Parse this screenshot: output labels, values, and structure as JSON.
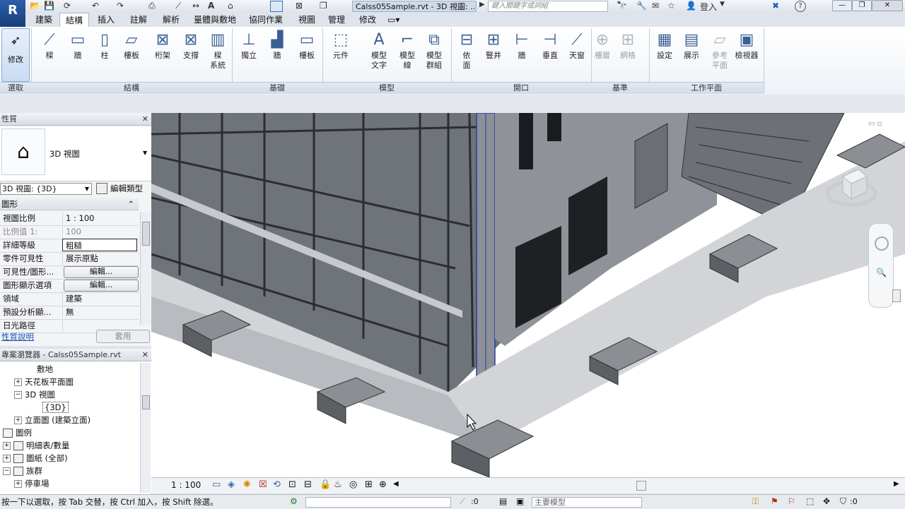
{
  "title_bar": {
    "doc_title": "Calss05Sample.rvt - 3D 視圖: ...",
    "search_placeholder": "鍵入關鍵字或詞組",
    "sign_in": "登入",
    "help": "?"
  },
  "tabs": [
    "建築",
    "結構",
    "插入",
    "註解",
    "解析",
    "量體與敷地",
    "協同作業",
    "視圖",
    "管理",
    "修改"
  ],
  "active_tab": "結構",
  "ribbon": {
    "modify": "修改",
    "select": "選取",
    "buttons": [
      {
        "label": "樑",
        "icon": "beam-icon"
      },
      {
        "label": "牆",
        "icon": "wall-icon"
      },
      {
        "label": "柱",
        "icon": "column-icon"
      },
      {
        "label": "樓板",
        "icon": "floor-icon"
      },
      {
        "label": "桁架",
        "icon": "truss-icon"
      },
      {
        "label": "支撐",
        "icon": "brace-icon"
      },
      {
        "label": "樑\n系統",
        "icon": "beam-system-icon"
      },
      {
        "label": "獨立",
        "icon": "isolated-foundation-icon"
      },
      {
        "label": "牆",
        "icon": "wall-foundation-icon"
      },
      {
        "label": "樓板",
        "icon": "slab-foundation-icon"
      },
      {
        "label": "元件",
        "icon": "component-icon"
      },
      {
        "label": "模型\n文字",
        "icon": "model-text-icon"
      },
      {
        "label": "模型\n線",
        "icon": "model-line-icon"
      },
      {
        "label": "模型\n群組",
        "icon": "model-group-icon"
      },
      {
        "label": "依\n面",
        "icon": "by-face-icon"
      },
      {
        "label": "豎井",
        "icon": "shaft-icon"
      },
      {
        "label": "牆",
        "icon": "wall-opening-icon"
      },
      {
        "label": "垂直",
        "icon": "vertical-opening-icon"
      },
      {
        "label": "天窗",
        "icon": "dormer-icon"
      },
      {
        "label": "樓層",
        "icon": "level-icon"
      },
      {
        "label": "網格",
        "icon": "grid-icon"
      },
      {
        "label": "設定",
        "icon": "set-icon"
      },
      {
        "label": "展示",
        "icon": "show-icon"
      },
      {
        "label": "參考\n平面",
        "icon": "ref-plane-icon"
      },
      {
        "label": "檢視器",
        "icon": "viewer-icon"
      }
    ],
    "panels": [
      "選取",
      "結構",
      "基礎",
      "模型",
      "開口",
      "基準",
      "工作平面"
    ]
  },
  "properties": {
    "header": "性質",
    "type_name": "3D 視圖",
    "selector_value": "3D 視圖: {3D}",
    "edit_type": "編輯類型",
    "section": "圖形",
    "rows": [
      {
        "k": "視圖比例",
        "v": "1 : 100"
      },
      {
        "k": "比例值 1:",
        "v": "100"
      },
      {
        "k": "詳細等級",
        "v": "粗糙"
      },
      {
        "k": "零件可見性",
        "v": "展示原點"
      },
      {
        "k": "可見性/圖形...",
        "v": "編輯..."
      },
      {
        "k": "圖形顯示選項",
        "v": "編輯..."
      },
      {
        "k": "領域",
        "v": "建築"
      },
      {
        "k": "預設分析顯...",
        "v": "無"
      },
      {
        "k": "日光路徑",
        "v": ""
      }
    ],
    "help_link": "性質說明",
    "apply": "套用"
  },
  "browser": {
    "header": "專案瀏覽器 - Calss05Sample.rvt",
    "items": [
      "敷地",
      "天花板平面圖",
      "3D 視圖",
      "{3D}",
      "立面圖 (建築立面)",
      "圖例",
      "明細表/數量",
      "圖紙 (全部)",
      "族群",
      "停車場"
    ]
  },
  "view_controls": {
    "scale": "1 : 100"
  },
  "status": {
    "message": "按一下以選取，按 Tab 交替，按 Ctrl 加入，按 Shift 除選。",
    "workset_count": ":0",
    "design_option": "主要模型",
    "filter_count": ":0"
  },
  "colors": {
    "ribbon_bg": "#f3f6fa",
    "accent": "#2d5fa8",
    "building_gray": "#7f8288"
  }
}
